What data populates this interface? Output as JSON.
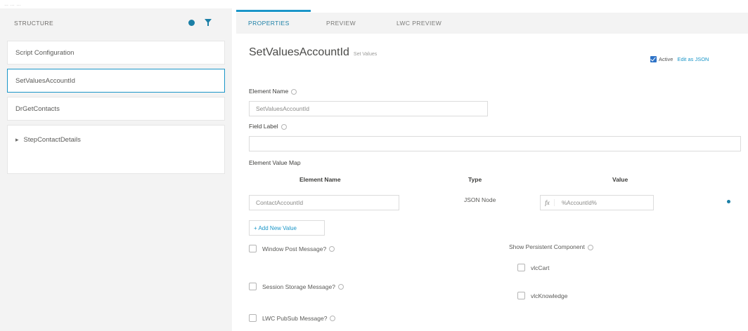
{
  "top_strip": {
    "text": "… … …"
  },
  "structure": {
    "title": "STRUCTURE",
    "items": [
      {
        "label": "Script Configuration"
      },
      {
        "label": "SetValuesAccountId"
      },
      {
        "label": "DrGetContacts"
      },
      {
        "label": "StepContactDetails",
        "bullet": "▸"
      }
    ]
  },
  "tabs": [
    {
      "label": "PROPERTIES"
    },
    {
      "label": "PREVIEW"
    },
    {
      "label": "LWC PREVIEW"
    }
  ],
  "element": {
    "name": "SetValuesAccountId",
    "type_label": "Set Values",
    "active_label": "Active",
    "active": true,
    "edit_json_label": "Edit as JSON"
  },
  "form": {
    "element_name_label": "Element Name",
    "element_name_value": "SetValuesAccountId",
    "field_label_label": "Field Label",
    "field_label_value": "",
    "value_map_label": "Element Value Map",
    "columns": {
      "element_name": "Element Name",
      "type": "Type",
      "value": "Value"
    },
    "rows": [
      {
        "element_name": "ContactAccountId",
        "type": "JSON Node",
        "fx": "fx",
        "value": "%AccountId%"
      }
    ],
    "add_value_label": "+ Add New Value",
    "left_checkboxes": [
      {
        "label": "Window Post Message?"
      },
      {
        "label": "Session Storage Message?"
      },
      {
        "label": "LWC PubSub Message?"
      }
    ],
    "persistent_label": "Show Persistent Component",
    "persistent_options": [
      {
        "label": "vlcCart"
      },
      {
        "label": "vlcKnowledge"
      }
    ]
  },
  "colors": {
    "accent": "#1b96c8",
    "accent_dark": "#1b7fa6",
    "checkbox_blue": "#2e73c7",
    "panel_bg": "#f3f3f3"
  },
  "icons": {
    "structure_dot": "dot-icon",
    "structure_filter": "filter-icon",
    "info": "info-icon",
    "remove_row": "remove-dot-icon"
  }
}
